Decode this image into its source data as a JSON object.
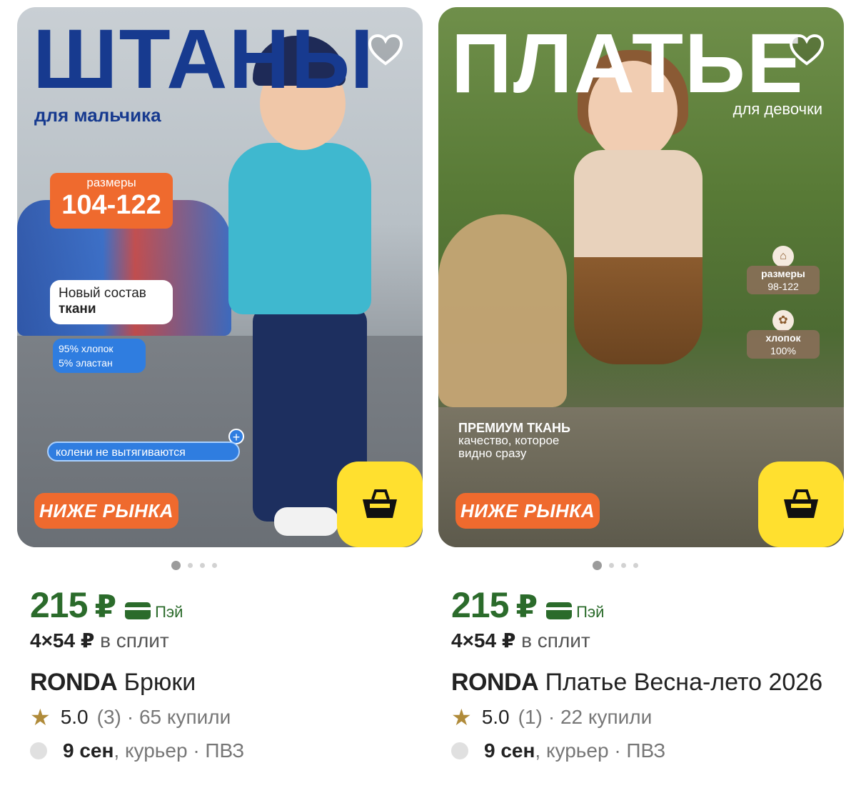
{
  "products": [
    {
      "image": {
        "headline": "ШТАНЫ",
        "subheadline": "для мальчика",
        "sizes_label": "размеры",
        "sizes_value": "104-122",
        "bubble_line1": "Новый состав",
        "bubble_line2": "ткани",
        "composition_line1": "95% хлопок",
        "composition_line2": "5% эластан",
        "knee_text": "колени не вытягиваются",
        "badge": "НИЖЕ РЫНКА",
        "slides": 4,
        "active_slide": 1
      },
      "price": "215",
      "currency": "₽",
      "pay_label": "Пэй",
      "split_amount": "4×54 ₽",
      "split_label": "в сплит",
      "brand": "RONDA",
      "name": "Брюки",
      "rating": "5.0",
      "reviews": "(3)",
      "bought": "· 65 купили",
      "delivery_date": "9 сен",
      "delivery_rest": ", курьер · ПВЗ"
    },
    {
      "image": {
        "headline": "ПЛАТЬЕ",
        "subheadline": "для девочки",
        "sizes_label": "размеры",
        "sizes_value": "98-122",
        "fabric_label": "хлопок",
        "fabric_value": "100%",
        "premium_line1": "ПРЕМИУМ ТКАНЬ",
        "premium_line2": "качество, которое",
        "premium_line3": "видно сразу",
        "badge": "НИЖЕ РЫНКА",
        "slides": 4,
        "active_slide": 1
      },
      "price": "215",
      "currency": "₽",
      "pay_label": "Пэй",
      "split_amount": "4×54 ₽",
      "split_label": "в сплит",
      "brand": "RONDA",
      "name": "Платье Весна-лето 2026",
      "rating": "5.0",
      "reviews": "(1)",
      "bought": "· 22 купили",
      "delivery_date": "9 сен",
      "delivery_rest": ", курьер · ПВЗ"
    }
  ],
  "icons": {
    "favorite": "heart-outline-icon",
    "cart": "basket-icon",
    "rating": "star-icon",
    "pay": "card-icon"
  },
  "colors": {
    "price_green": "#2b6b2b",
    "cart_yellow": "#ffe02f",
    "badge_orange": "#ef6a2e",
    "star_gold": "#b08b3a"
  }
}
